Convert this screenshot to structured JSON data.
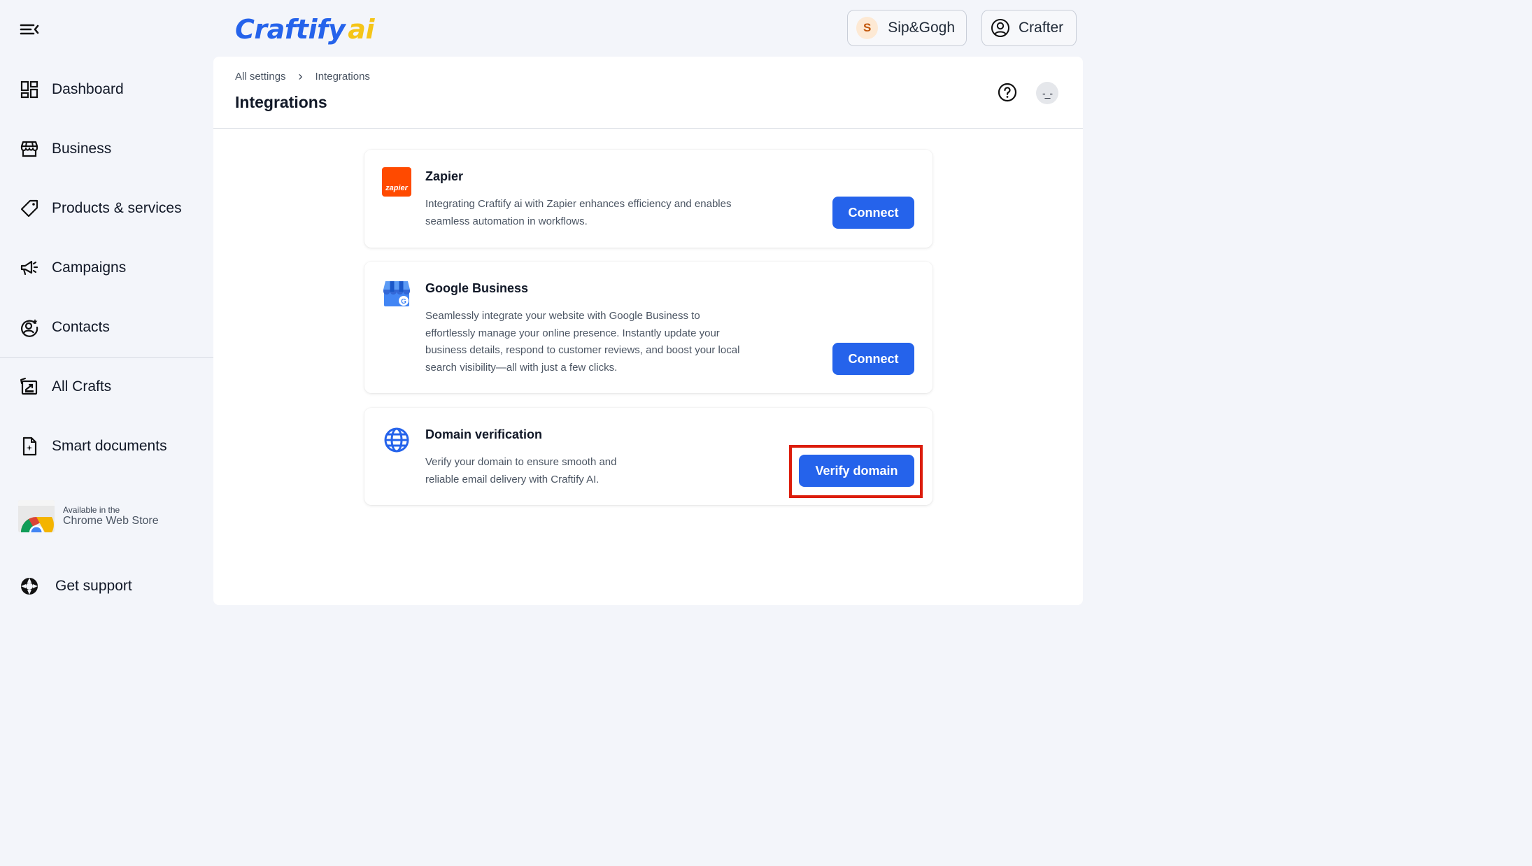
{
  "app": {
    "logo_main": "Craftify",
    "logo_suffix": "ai",
    "business_switcher": {
      "initial": "S",
      "name": "Sip&Gogh"
    },
    "user_menu": {
      "name": "Crafter"
    }
  },
  "sidebar": {
    "items": [
      {
        "label": "Dashboard",
        "icon": "dashboard-icon"
      },
      {
        "label": "Business",
        "icon": "store-icon"
      },
      {
        "label": "Products & services",
        "icon": "tag-icon"
      },
      {
        "label": "Campaigns",
        "icon": "megaphone-icon"
      },
      {
        "label": "Contacts",
        "icon": "contact-icon"
      },
      {
        "label": "All Crafts",
        "icon": "crafts-icon"
      },
      {
        "label": "Smart documents",
        "icon": "document-icon"
      }
    ],
    "chrome_store": {
      "small": "Available in the",
      "big": "Chrome Web Store"
    },
    "support": {
      "label": "Get support",
      "icon": "lifebuoy-icon"
    }
  },
  "header": {
    "breadcrumb": [
      "All settings",
      "Integrations"
    ],
    "title": "Integrations",
    "avatar_text": "-_-"
  },
  "integrations": [
    {
      "title": "Zapier",
      "logo_text": "zapier",
      "description_lines": [
        "Integrating Craftify ai with Zapier enhances efficiency and enables",
        "seamless automation in workflows."
      ],
      "button": "Connect"
    },
    {
      "title": "Google Business",
      "description_lines": [
        "Seamlessly integrate your website with Google Business to",
        "effortlessly manage your online presence. Instantly update your",
        "business details, respond to customer reviews, and boost your local",
        "search visibility—all with just a few clicks."
      ],
      "button": "Connect"
    },
    {
      "title": "Domain verification",
      "description_lines": [
        "Verify your domain to ensure smooth and",
        "reliable email delivery with Craftify AI."
      ],
      "button": "Verify domain"
    }
  ],
  "colors": {
    "accent": "#2563eb",
    "logo_ai": "#f5c518",
    "zapier": "#ff4a00",
    "highlight": "#dc1d0b",
    "background": "#f3f5fa"
  }
}
